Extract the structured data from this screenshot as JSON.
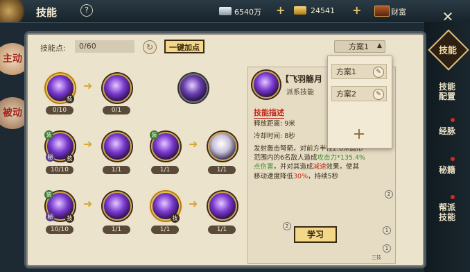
{
  "header": {
    "title": "技能",
    "help": "?",
    "silver": "6540万",
    "gold": "24541",
    "wealth": "财富"
  },
  "side_tabs": [
    "主动",
    "被动"
  ],
  "right_nav": [
    {
      "label": "技能",
      "active": true
    },
    {
      "label": "技能\n配置",
      "dot": false
    },
    {
      "label": "经脉",
      "dot": true
    },
    {
      "label": "秘籍",
      "dot": true
    },
    {
      "label": "帮派\n技能",
      "dot": true
    }
  ],
  "toolbar": {
    "points_label": "技能点:",
    "points_value": "0/60",
    "refresh": "↻",
    "onekey": "一键加点",
    "plan_selected": "方案1",
    "plan_caret": "▲"
  },
  "skill_rows": [
    [
      {
        "level": "0/10",
        "badges": [
          "技"
        ],
        "style": "gold"
      },
      {
        "level": "0/1"
      },
      {
        "level": null,
        "style": "grey"
      }
    ],
    [
      {
        "level": "10/10",
        "badges": [
          "秘",
          "技",
          "装"
        ]
      },
      {
        "level": "1/1"
      },
      {
        "level": "1/1",
        "badges": [
          "装"
        ]
      },
      {
        "level": "1/1"
      }
    ],
    [
      {
        "level": "10/10",
        "badges": [
          "秘",
          "技",
          "装"
        ]
      },
      {
        "level": "1/1"
      },
      {
        "level": "1/1",
        "badges": [
          "技"
        ],
        "style": "gold"
      },
      {
        "level": "1/1"
      }
    ]
  ],
  "detail": {
    "name": "【飞羽觞月",
    "type": "派系技能",
    "desc_title": "技能描述",
    "range": "释放距离: 9米",
    "cooldown": "冷却时间: 8秒",
    "desc_line1": "发射轰击弩箭，对前方半径2.8米圆形",
    "desc_line2a": "范围内的6名敌人造成",
    "desc_line2b": "攻击力*135.4%",
    "desc_line3a": "点伤害",
    "desc_line3b": "，并对其造成",
    "desc_line3c": "减速",
    "desc_line3d": "效果，使其",
    "desc_line4a": "移动速度降低",
    "desc_line4b": "30%",
    "desc_line4c": "，持续5秒",
    "learn": "学习",
    "markers": [
      "2",
      "2",
      "1",
      "1"
    ],
    "page": "三技"
  },
  "plans": {
    "items": [
      "方案1",
      "方案2"
    ],
    "add": "+",
    "edit_icon": "✎"
  },
  "colors": {
    "accent_gold": "#f2d888",
    "panel_bg": "#ece3cd",
    "highlight_green": "#3b8e2f",
    "highlight_red": "#c0321f"
  }
}
